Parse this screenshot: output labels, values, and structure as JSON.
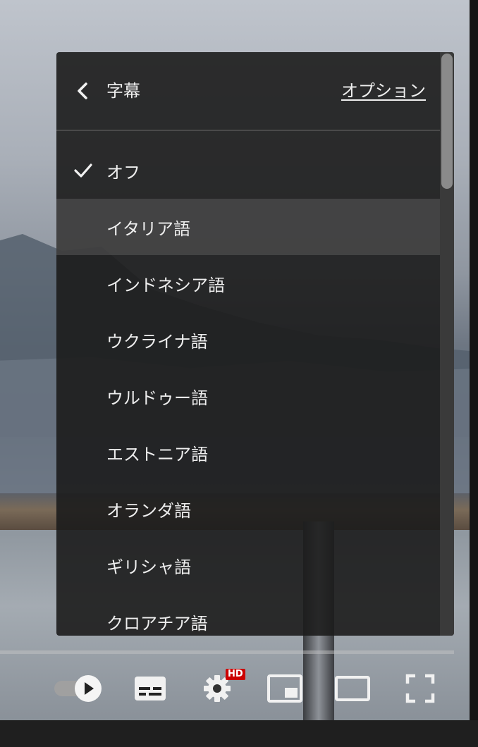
{
  "panel": {
    "back_icon": "chevron-left-icon",
    "title": "字幕",
    "options_label": "オプション",
    "items": [
      {
        "label": "オフ",
        "selected": true
      },
      {
        "label": "イタリア語",
        "selected": false,
        "hovered": true
      },
      {
        "label": "インドネシア語",
        "selected": false
      },
      {
        "label": "ウクライナ語",
        "selected": false
      },
      {
        "label": "ウルドゥー語",
        "selected": false
      },
      {
        "label": "エストニア語",
        "selected": false
      },
      {
        "label": "オランダ語",
        "selected": false
      },
      {
        "label": "ギリシャ語",
        "selected": false
      },
      {
        "label": "クロアチア語",
        "selected": false
      }
    ]
  },
  "controls": {
    "autoplay_icon": "autoplay-toggle-icon",
    "subtitles_icon": "subtitles-icon",
    "settings_icon": "gear-icon",
    "hd_badge": "HD",
    "miniplayer_icon": "miniplayer-icon",
    "theater_icon": "theater-mode-icon",
    "fullscreen_icon": "fullscreen-icon"
  },
  "colors": {
    "panel_bg": "#1c1c1c",
    "highlight": "#474747",
    "hd_badge": "#cc0000",
    "text": "#eeeeee"
  }
}
